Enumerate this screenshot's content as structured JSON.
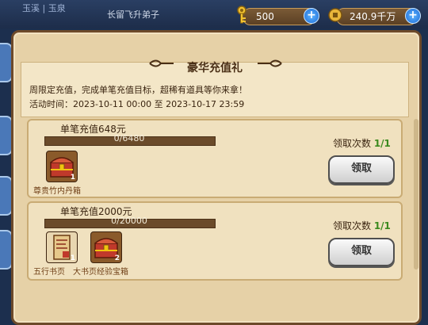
{
  "background": {
    "bg_text_left": "玉溪 | 玉泉",
    "bg_text_right": "长留飞升弟子"
  },
  "resources": {
    "keys_value": "500",
    "coins_value": "240.9千万",
    "keys_icon": "key-icon",
    "coins_icon": "coin-icon"
  },
  "panel": {
    "title": "豪华充值礼",
    "description": "周限定充值，完成单笔充值目标，超稀有道具等你来拿！",
    "time_label": "活动时间：",
    "time_range": "2023-10-11 00:00 至 2023-10-17 23:59"
  },
  "tasks": [
    {
      "title": "单笔充值648元",
      "progress_text": "0/6480",
      "progress_fraction": 0,
      "claim_label": "领取次数 ",
      "claim_count": "1/1",
      "button_label": "领取",
      "rewards": [
        {
          "name": "尊贵竹内丹箱",
          "qty": "1",
          "icon": "treasure-chest-icon"
        }
      ]
    },
    {
      "title": "单笔充值2000元",
      "progress_text": "0/20000",
      "progress_fraction": 0,
      "claim_label": "领取次数 ",
      "claim_count": "1/1",
      "button_label": "领取",
      "rewards": [
        {
          "name": "五行书页",
          "qty": "1",
          "icon": "scroll-page-icon"
        },
        {
          "name": "大书页经验宝箱",
          "qty": "2",
          "icon": "treasure-chest-icon"
        }
      ]
    }
  ],
  "colors": {
    "accent_green": "#3b8a1e",
    "panel_bg": "#e6d1a7"
  }
}
